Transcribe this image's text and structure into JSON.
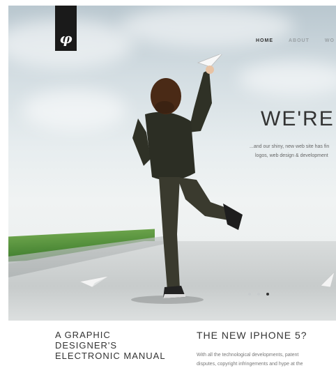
{
  "logo": {
    "mark": "φ",
    "icon": "phi-logo-icon"
  },
  "nav": {
    "items": [
      "HOME",
      "ABOUT",
      "WO"
    ],
    "active_index": 0
  },
  "hero": {
    "headline": "WE'RE",
    "sub_line_1": "...and our shiny, new web site has fin",
    "sub_line_2": "logos, web design & development",
    "slider": {
      "count": 3,
      "active_index": 2
    }
  },
  "articles": [
    {
      "title_lines": [
        "A GRAPHIC",
        "DESIGNER'S",
        "ELECTRONIC MANUAL"
      ]
    },
    {
      "title": "THE NEW IPHONE 5?",
      "body_lines": [
        "With all the technological developments, patent",
        "disputes, copyright infringements and hype at the"
      ]
    }
  ],
  "colors": {
    "logo_bg": "#1a1a1a",
    "text_dark": "#333333",
    "nav_inactive": "#9aa1a5",
    "grass": "#5a9640"
  }
}
